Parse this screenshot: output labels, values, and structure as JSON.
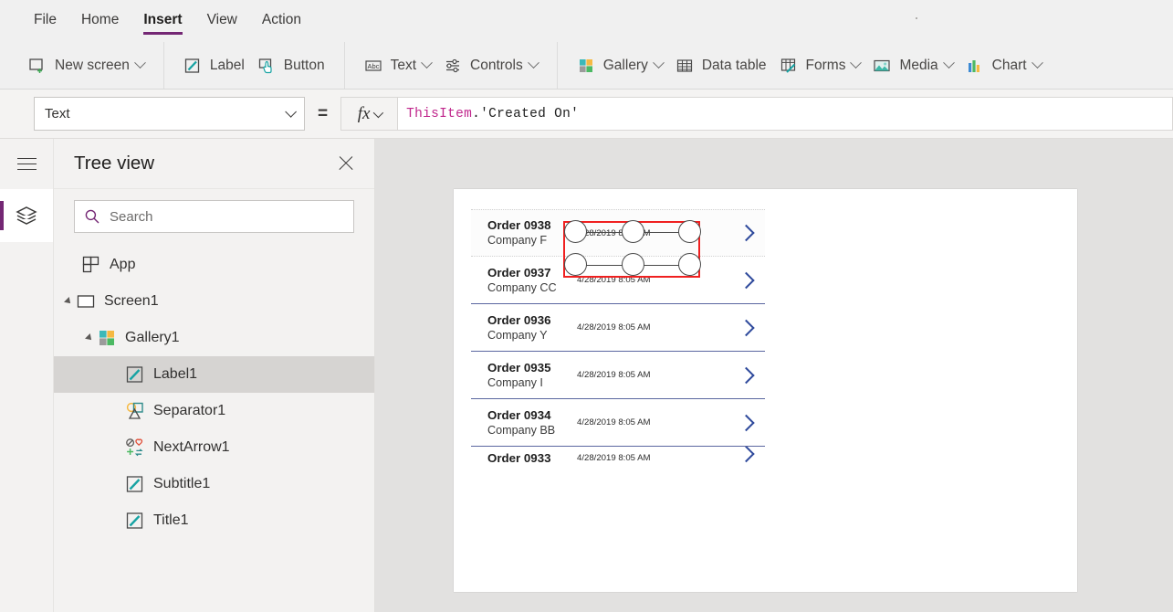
{
  "menubar": {
    "items": [
      {
        "label": "File",
        "active": false
      },
      {
        "label": "Home",
        "active": false
      },
      {
        "label": "Insert",
        "active": true
      },
      {
        "label": "View",
        "active": false
      },
      {
        "label": "Action",
        "active": false
      }
    ]
  },
  "ribbon": {
    "groups": [
      {
        "items": [
          {
            "label": "New screen",
            "icon": "new-screen-icon",
            "caret": true
          }
        ]
      },
      {
        "items": [
          {
            "label": "Label",
            "icon": "label-icon",
            "caret": false
          },
          {
            "label": "Button",
            "icon": "button-icon",
            "caret": false
          }
        ]
      },
      {
        "items": [
          {
            "label": "Text",
            "icon": "text-abc-icon",
            "caret": true
          },
          {
            "label": "Controls",
            "icon": "controls-sliders-icon",
            "caret": true
          }
        ]
      },
      {
        "items": [
          {
            "label": "Gallery",
            "icon": "gallery-icon",
            "caret": true
          },
          {
            "label": "Data table",
            "icon": "data-table-icon",
            "caret": false
          },
          {
            "label": "Forms",
            "icon": "forms-icon",
            "caret": true
          },
          {
            "label": "Media",
            "icon": "media-image-icon",
            "caret": true
          },
          {
            "label": "Chart",
            "icon": "chart-bars-icon",
            "caret": true
          }
        ]
      }
    ]
  },
  "formula_bar": {
    "property_selected": "Text",
    "equals": "=",
    "fx_glyph": "fx",
    "formula_object": "ThisItem",
    "formula_rest": ".'Created On'"
  },
  "tree_panel": {
    "title": "Tree view",
    "search_placeholder": "Search",
    "items": [
      {
        "label": "App",
        "icon": "app-icon",
        "depth": 0,
        "arrow": false,
        "selected": false
      },
      {
        "label": "Screen1",
        "icon": "screen-icon",
        "depth": 0,
        "arrow": true,
        "selected": false
      },
      {
        "label": "Gallery1",
        "icon": "gallery-icon",
        "depth": 1,
        "arrow": true,
        "selected": false
      },
      {
        "label": "Label1",
        "icon": "label-icon",
        "depth": 2,
        "arrow": false,
        "selected": true
      },
      {
        "label": "Separator1",
        "icon": "separator-icon",
        "depth": 2,
        "arrow": false,
        "selected": false
      },
      {
        "label": "NextArrow1",
        "icon": "next-arrow-icon",
        "depth": 2,
        "arrow": false,
        "selected": false
      },
      {
        "label": "Subtitle1",
        "icon": "label-icon",
        "depth": 2,
        "arrow": false,
        "selected": false
      },
      {
        "label": "Title1",
        "icon": "label-icon",
        "depth": 2,
        "arrow": false,
        "selected": false
      }
    ]
  },
  "canvas": {
    "gallery_rows": [
      {
        "title": "Order 0938",
        "subtitle": "Company F",
        "date": "4/28/2019 8:05 AM",
        "selected": true,
        "clipped": false
      },
      {
        "title": "Order 0937",
        "subtitle": "Company CC",
        "date": "4/28/2019 8:05 AM",
        "selected": false,
        "clipped": false
      },
      {
        "title": "Order 0936",
        "subtitle": "Company Y",
        "date": "4/28/2019 8:05 AM",
        "selected": false,
        "clipped": false
      },
      {
        "title": "Order 0935",
        "subtitle": "Company I",
        "date": "4/28/2019 8:05 AM",
        "selected": false,
        "clipped": false
      },
      {
        "title": "Order 0934",
        "subtitle": "Company BB",
        "date": "4/28/2019 8:05 AM",
        "selected": false,
        "clipped": false
      },
      {
        "title": "Order 0933",
        "subtitle": "",
        "date": "4/28/2019 8:05 AM",
        "selected": false,
        "clipped": true
      }
    ]
  },
  "colors": {
    "accent_purple": "#742774",
    "selection_red": "#f02020",
    "chevron_blue": "#2f4a9c",
    "formula_object_pink": "#c0278c",
    "panel_gray": "#f3f2f1",
    "canvas_gray": "#e2e1e0"
  }
}
